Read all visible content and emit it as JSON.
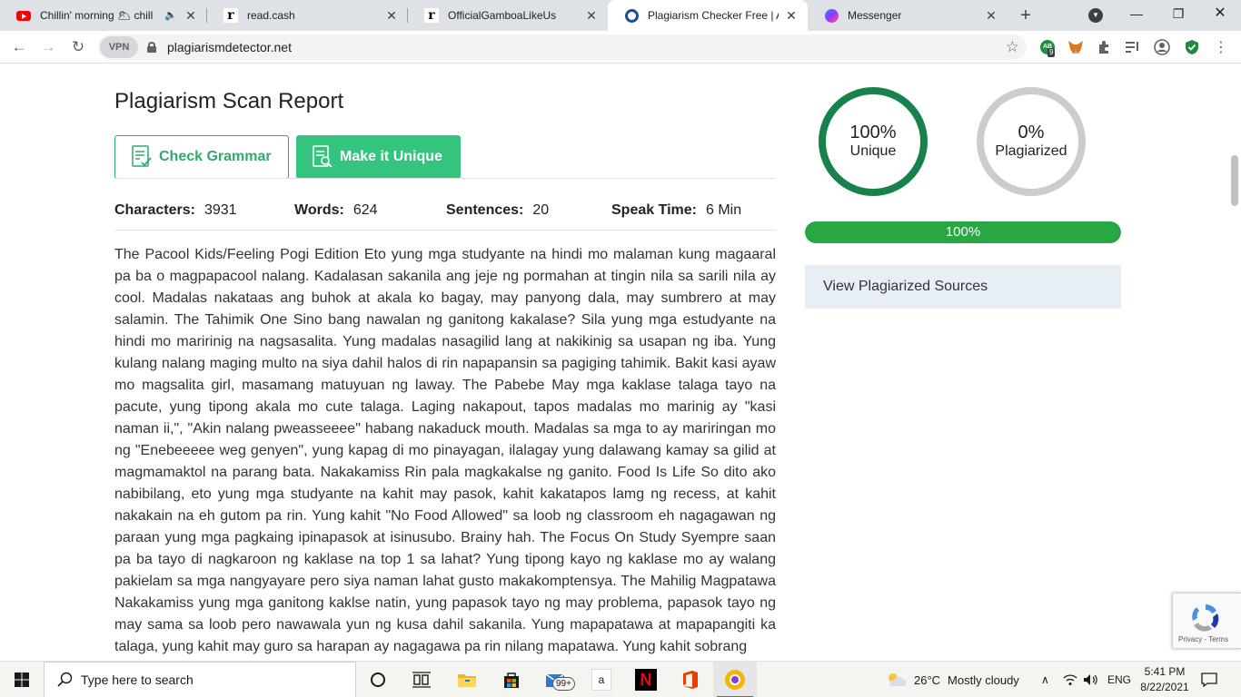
{
  "browser": {
    "tabs": [
      {
        "title": "Chillin' morning 🌥 chill",
        "icon": "youtube-icon",
        "audio": true
      },
      {
        "title": "read.cash",
        "icon": "readcash-icon"
      },
      {
        "title": "OfficialGamboaLikeUs",
        "icon": "readcash-icon"
      },
      {
        "title": "Plagiarism Checker Free | Acc",
        "icon": "plagiarism-detector-icon",
        "active": true
      },
      {
        "title": "Messenger",
        "icon": "messenger-icon"
      }
    ],
    "address": {
      "vpn_label": "VPN",
      "url": "plagiarismdetector.net"
    },
    "extension_badge": "9",
    "extension_ab_label": "AB"
  },
  "report": {
    "title": "Plagiarism Scan Report",
    "check_grammar_label": "Check Grammar",
    "make_unique_label": "Make it Unique",
    "stats": {
      "characters_label": "Characters:",
      "characters_value": "3931",
      "words_label": "Words:",
      "words_value": "624",
      "sentences_label": "Sentences:",
      "sentences_value": "20",
      "speak_time_label": "Speak Time:",
      "speak_time_value": "6 Min"
    },
    "text": "The Pacool Kids/Feeling Pogi Edition Eto yung mga studyante na hindi mo malaman kung magaaral pa ba o magpapacool nalang. Kadalasan sakanila ang jeje ng pormahan at tingin nila sa sarili nila ay cool. Madalas nakataas ang buhok at akala ko bagay, may panyong dala, may sumbrero at may salamin. The Tahimik One Sino bang nawalan ng ganitong kakalase? Sila yung mga estudyante na hindi mo maririnig na nagsasalita. Yung madalas nasagilid lang at nakikinig sa usapan ng iba. Yung kulang nalang maging multo na siya dahil halos di rin napapansin sa pagiging tahimik. Bakit kasi ayaw mo magsalita girl, masamang matuyuan ng laway. The Pabebe May mga kaklase talaga tayo na pacute, yung tipong akala mo cute talaga. Laging nakapout, tapos madalas mo marinig ay \"kasi naman ii,\", \"Akin nalang pweasseeee\" habang nakaduck mouth. Madalas sa mga to ay mariringan mo ng \"Enebeeeee weg genyen\", yung kapag di mo pinayagan, ilalagay yung dalawang kamay sa gilid at magmamaktol na parang bata. Nakakamiss Rin pala magkakalse ng ganito. Food Is Life So dito ako nabibilang, eto yung mga studyante na kahit may pasok, kahit kakatapos lamg ng recess, at kahit nakakain na eh gutom pa rin. Yung kahit \"No Food Allowed\" sa loob ng classroom eh nagagawan ng paraan yung mga pagkaing ipinapasok at isinusubo. Brainy hah. The Focus On Study Syempre saan pa ba tayo di nagkaroon ng kaklase na top 1 sa lahat? Yung tipong kayo ng kaklase mo ay walang pakielam sa mga nangyayare pero siya naman lahat gusto makakomptensya. The Mahilig Magpatawa Nakakamiss yung mga ganitong kaklse natin, yung papasok tayo ng may problema, papasok tayo ng may sama sa loob pero nawawala yun ng kusa dahil sakanila. Yung mapapatawa at mapapangiti ka talaga, yung kahit may guro sa harapan ay nagagawa pa rin nilang mapatawa. Yung kahit sobrang",
    "unique": {
      "percent": "100%",
      "label": "Unique",
      "color": "#17824c"
    },
    "plagiarized": {
      "percent": "0%",
      "label": "Plagiarized",
      "color": "#cccccc"
    },
    "progress": {
      "value": 1.0,
      "label": "100%",
      "color": "#28a745"
    },
    "sources_label": "View Plagiarized Sources"
  },
  "recaptcha": {
    "links": "Privacy - Terms"
  },
  "taskbar": {
    "search_placeholder": "Type here to search",
    "mail_badge": "99+",
    "weather_temp": "26°C",
    "weather_desc": "Mostly cloudy",
    "language": "ENG",
    "time": "5:41 PM",
    "date": "8/22/2021"
  }
}
